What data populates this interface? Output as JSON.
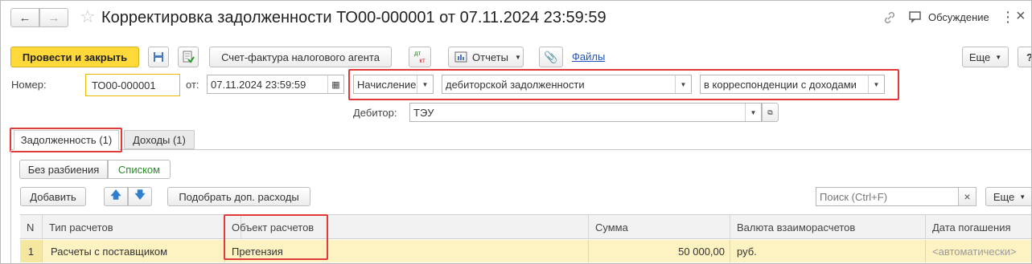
{
  "window": {
    "title": "Корректировка задолженности ТО00-000001 от 07.11.2024 23:59:59",
    "discuss": "Обсуждение"
  },
  "toolbar": {
    "post_close": "Провести и закрыть",
    "invoice": "Счет-фактура налогового агента",
    "dtkt_top": "дт",
    "dtkt_bottom": "кт",
    "reports": "Отчеты",
    "files": "Файлы",
    "more": "Еще",
    "help": "?"
  },
  "form": {
    "number_label": "Номер:",
    "number_value": "ТО00-000001",
    "date_label": "от:",
    "date_value": "07.11.2024 23:59:59",
    "op_type": "Начисление",
    "op_object": "дебиторской задолженности",
    "op_corr": "в корреспонденции с доходами",
    "debtor_label": "Дебитор:",
    "debtor_value": "ТЭУ"
  },
  "tabs": [
    {
      "label": "Задолженность (1)",
      "active": true
    },
    {
      "label": "Доходы (1)",
      "active": false
    }
  ],
  "view_toggle": {
    "no_split": "Без разбиения",
    "list": "Списком"
  },
  "table_toolbar": {
    "add": "Добавить",
    "pick_costs": "Подобрать доп. расходы",
    "search_placeholder": "Поиск (Ctrl+F)",
    "more": "Еще"
  },
  "table": {
    "columns": [
      "N",
      "Тип расчетов",
      "Объект расчетов",
      "Сумма",
      "Валюта взаиморасчетов",
      "Дата погашения"
    ],
    "rows": [
      {
        "n": "1",
        "type": "Расчеты с поставщиком",
        "object": "Претензия",
        "sum": "50 000,00",
        "currency": "руб.",
        "date": "<автоматически>"
      }
    ]
  },
  "colors": {
    "accent_yellow": "#ffd83a",
    "highlight_red": "#e03a3a",
    "row_highlight": "#fdf2c2",
    "link_blue": "#2353b8",
    "active_green": "#2a8a2a"
  }
}
